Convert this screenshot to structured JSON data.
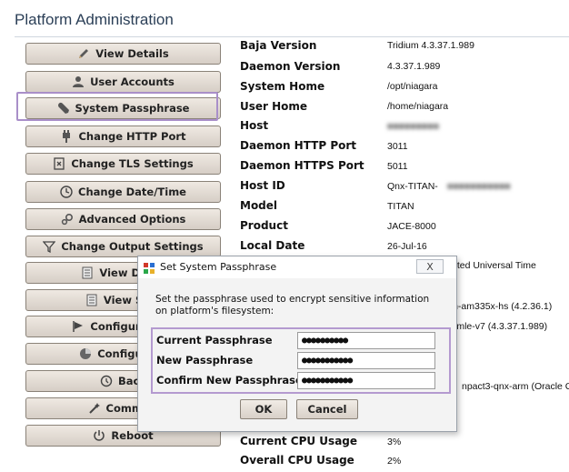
{
  "header": {
    "title": "Platform Administration"
  },
  "sidebar": {
    "items": [
      {
        "label": "View Details",
        "icon": "pencil-icon"
      },
      {
        "label": "User Accounts",
        "icon": "user-icon"
      },
      {
        "label": "System Passphrase",
        "icon": "wrench-icon"
      },
      {
        "label": "Change HTTP Port",
        "icon": "plug-icon"
      },
      {
        "label": "Change TLS Settings",
        "icon": "tls-icon"
      },
      {
        "label": "Change Date/Time",
        "icon": "clock-icon"
      },
      {
        "label": "Advanced Options",
        "icon": "gears-icon"
      },
      {
        "label": "Change Output Settings",
        "icon": "filter-icon"
      },
      {
        "label": "View Daem",
        "icon": "document-icon"
      },
      {
        "label": "View Syst",
        "icon": "document-icon"
      },
      {
        "label": "Configure Run",
        "icon": "flag-icon"
      },
      {
        "label": "Configure N",
        "icon": "network-icon"
      },
      {
        "label": "Back",
        "icon": "history-icon"
      },
      {
        "label": "Commiss",
        "icon": "wand-icon"
      },
      {
        "label": "Reboot",
        "icon": "power-icon"
      }
    ]
  },
  "properties": [
    {
      "key": "Baja Version",
      "value": "Tridium 4.3.37.1.989"
    },
    {
      "key": "Daemon Version",
      "value": "4.3.37.1.989"
    },
    {
      "key": "System Home",
      "value": "/opt/niagara"
    },
    {
      "key": "User Home",
      "value": "/home/niagara"
    },
    {
      "key": "Host",
      "value": ""
    },
    {
      "key": "Daemon HTTP Port",
      "value": "3011"
    },
    {
      "key": "Daemon HTTPS Port",
      "value": "5011"
    },
    {
      "key": "Host ID",
      "value": "Qnx-TITAN-"
    },
    {
      "key": "Model",
      "value": "TITAN"
    },
    {
      "key": "Product",
      "value": "JACE-8000"
    },
    {
      "key": "Local Date",
      "value": "26-Jul-16"
    },
    {
      "key": "Current CPU Usage",
      "value": "3%"
    },
    {
      "key": "Overall CPU Usage",
      "value": "2%"
    }
  ],
  "partial_values": [
    "ated Universal Time",
    "itan-am335x-hs (4.2.36.1)",
    "armle-v7 (4.3.37.1.989)",
    "npact3-qnx-arm (Oracle C"
  ],
  "dialog": {
    "title": "Set System Passphrase",
    "close_label": "X",
    "message": "Set the passphrase used to encrypt sensitive information on platform's filesystem:",
    "fields": [
      {
        "label": "Current Passphrase",
        "value": "●●●●●●●●●●"
      },
      {
        "label": "New Passphrase",
        "value": "●●●●●●●●●●●"
      },
      {
        "label": "Confirm New Passphrase",
        "value": "●●●●●●●●●●●"
      }
    ],
    "ok_label": "OK",
    "cancel_label": "Cancel"
  },
  "colors": {
    "highlight": "#a98fc9",
    "title_text": "#2b3f57",
    "button_face": "#e2dbd3"
  }
}
